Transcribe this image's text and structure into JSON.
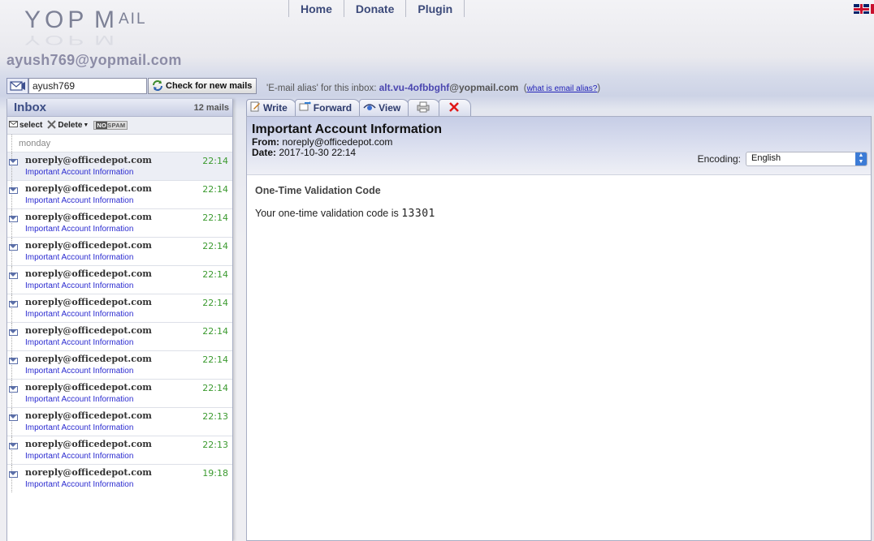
{
  "brand": {
    "logo_text": "YOPMAIL"
  },
  "nav": [
    "Home",
    "Donate",
    "Plugin"
  ],
  "mailbox_title": "ayush769@yopmail.com",
  "login": {
    "value": "ayush769",
    "check_button": "Check for new mails"
  },
  "alias": {
    "label": "'E-mail alias' for this inbox:",
    "alias_name": "alt.vu-4ofbbghf",
    "alias_domain": "@yopmail.com",
    "help_link": "what is email alias?"
  },
  "inbox": {
    "title": "Inbox",
    "count": "12 mails",
    "toolbar": {
      "select": "select",
      "delete": "Delete",
      "nospam_no": "NO",
      "nospam_spam": "SPAM"
    },
    "day_label": "monday",
    "mails": [
      {
        "from": "noreply@officedepot.com",
        "subject": "Important Account Information",
        "time": "22:14"
      },
      {
        "from": "noreply@officedepot.com",
        "subject": "Important Account Information",
        "time": "22:14"
      },
      {
        "from": "noreply@officedepot.com",
        "subject": "Important Account Information",
        "time": "22:14"
      },
      {
        "from": "noreply@officedepot.com",
        "subject": "Important Account Information",
        "time": "22:14"
      },
      {
        "from": "noreply@officedepot.com",
        "subject": "Important Account Information",
        "time": "22:14"
      },
      {
        "from": "noreply@officedepot.com",
        "subject": "Important Account Information",
        "time": "22:14"
      },
      {
        "from": "noreply@officedepot.com",
        "subject": "Important Account Information",
        "time": "22:14"
      },
      {
        "from": "noreply@officedepot.com",
        "subject": "Important Account Information",
        "time": "22:14"
      },
      {
        "from": "noreply@officedepot.com",
        "subject": "Important Account Information",
        "time": "22:14"
      },
      {
        "from": "noreply@officedepot.com",
        "subject": "Important Account Information",
        "time": "22:13"
      },
      {
        "from": "noreply@officedepot.com",
        "subject": "Important Account Information",
        "time": "22:13"
      },
      {
        "from": "noreply@officedepot.com",
        "subject": "Important Account Information",
        "time": "19:18"
      }
    ]
  },
  "tabs": {
    "write": "Write",
    "forward": "Forward",
    "view": "View"
  },
  "message": {
    "subject": "Important Account Information",
    "from_label": "From:",
    "from": "noreply@officedepot.com",
    "date_label": "Date:",
    "date": "2017-10-30 22:14",
    "encoding_label": "Encoding:",
    "encoding_value": "English",
    "body_heading": "One-Time Validation Code",
    "body_text": "Your one-time validation code is",
    "body_code": "13301"
  },
  "colors": {
    "time_green": "#3b9a2f",
    "subject_blue": "#2b2bd0",
    "accent": "#3c4d85"
  }
}
